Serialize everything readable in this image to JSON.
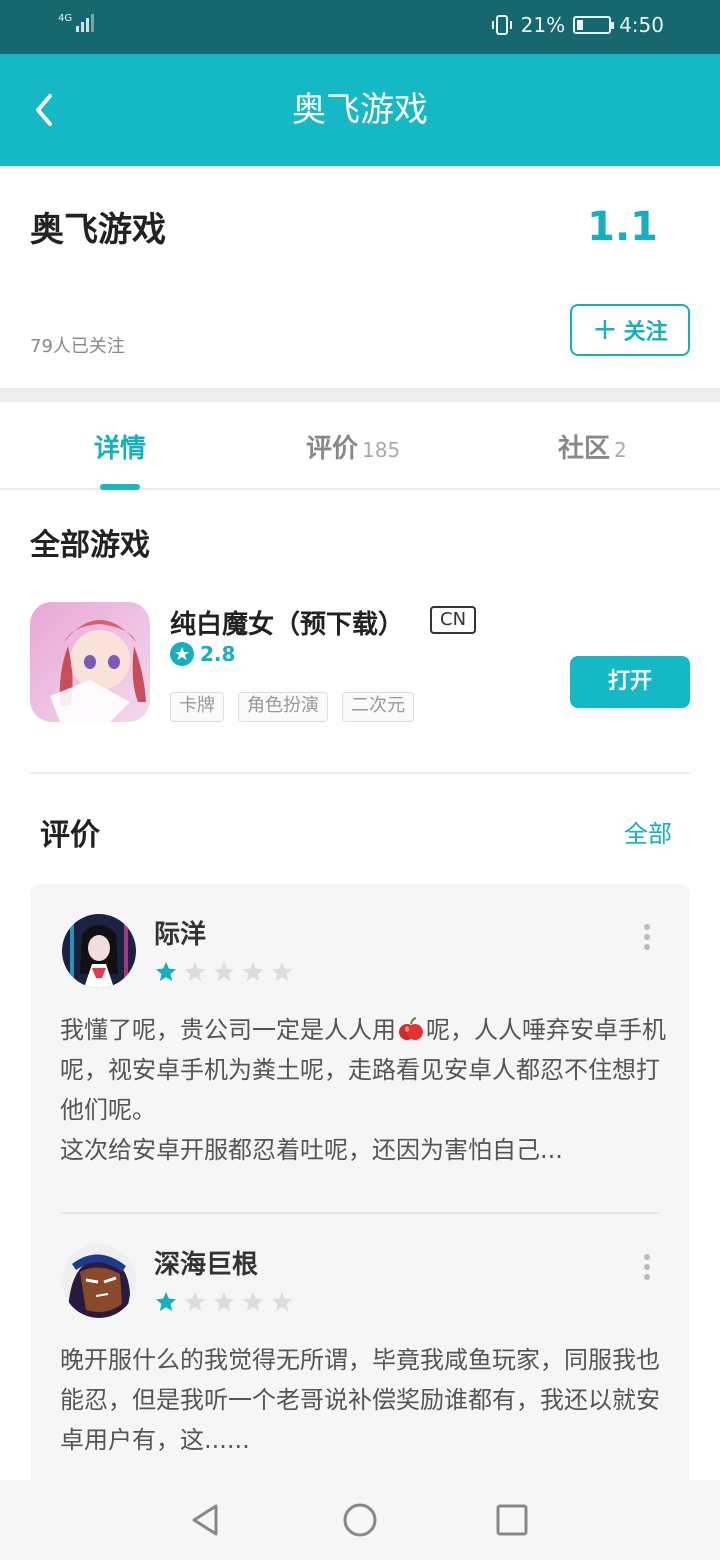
{
  "status_bar": {
    "network": "4G",
    "battery_percent": "21%",
    "battery_level": 0.21,
    "time": "4:50"
  },
  "nav": {
    "title": "奥飞游戏"
  },
  "header": {
    "name": "奥飞游戏",
    "score": "1.1",
    "followers": "79人已关注",
    "follow_label": "关注"
  },
  "tabs": [
    {
      "label": "详情",
      "count": ""
    },
    {
      "label": "评价",
      "count": "185"
    },
    {
      "label": "社区",
      "count": "2"
    }
  ],
  "games_section": {
    "title": "全部游戏"
  },
  "game": {
    "name": "纯白魔女（预下载）",
    "region_badge": "CN",
    "rating": "2.8",
    "tags": [
      "卡牌",
      "角色扮演",
      "二次元"
    ],
    "open_label": "打开"
  },
  "reviews_section": {
    "title": "评价",
    "all_label": "全部"
  },
  "reviews": [
    {
      "user": "际洋",
      "stars": 1,
      "text_before_icon": "我懂了呢，贵公司一定是人人用",
      "text_after_icon": "呢，人人唾弃安卓手机呢，视安卓手机为粪土呢，走路看见安卓人都忍不住想打他们呢。\n这次给安卓开服都忍着吐呢，还因为害怕自己..."
    },
    {
      "user": "深海巨根",
      "stars": 1,
      "text": "晚开服什么的我觉得无所谓，毕竟我咸鱼玩家，同服我也能忍，但是我听一个老哥说补偿奖励谁都有，我还以就安卓用户有，这......"
    }
  ],
  "colors": {
    "accent": "#15b8c5",
    "accent_text": "#15b0bd",
    "status_bar": "#17676e"
  }
}
